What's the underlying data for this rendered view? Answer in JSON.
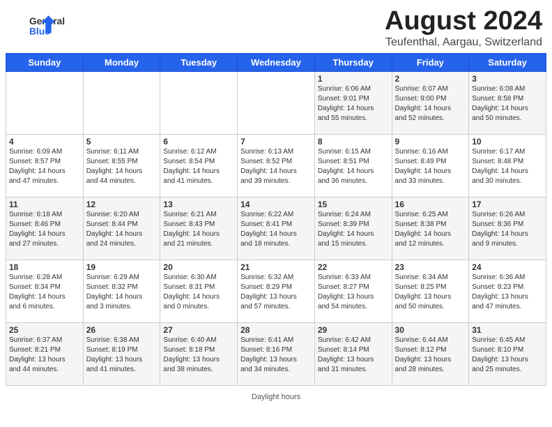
{
  "header": {
    "logo": {
      "line1": "General",
      "line2": "Blue"
    },
    "title": "August 2024",
    "subtitle": "Teufenthal, Aargau, Switzerland"
  },
  "days_of_week": [
    "Sunday",
    "Monday",
    "Tuesday",
    "Wednesday",
    "Thursday",
    "Friday",
    "Saturday"
  ],
  "weeks": [
    [
      {
        "day": "",
        "info": ""
      },
      {
        "day": "",
        "info": ""
      },
      {
        "day": "",
        "info": ""
      },
      {
        "day": "",
        "info": ""
      },
      {
        "day": "1",
        "info": "Sunrise: 6:06 AM\nSunset: 9:01 PM\nDaylight: 14 hours\nand 55 minutes."
      },
      {
        "day": "2",
        "info": "Sunrise: 6:07 AM\nSunset: 9:00 PM\nDaylight: 14 hours\nand 52 minutes."
      },
      {
        "day": "3",
        "info": "Sunrise: 6:08 AM\nSunset: 8:58 PM\nDaylight: 14 hours\nand 50 minutes."
      }
    ],
    [
      {
        "day": "4",
        "info": "Sunrise: 6:09 AM\nSunset: 8:57 PM\nDaylight: 14 hours\nand 47 minutes."
      },
      {
        "day": "5",
        "info": "Sunrise: 6:11 AM\nSunset: 8:55 PM\nDaylight: 14 hours\nand 44 minutes."
      },
      {
        "day": "6",
        "info": "Sunrise: 6:12 AM\nSunset: 8:54 PM\nDaylight: 14 hours\nand 41 minutes."
      },
      {
        "day": "7",
        "info": "Sunrise: 6:13 AM\nSunset: 8:52 PM\nDaylight: 14 hours\nand 39 minutes."
      },
      {
        "day": "8",
        "info": "Sunrise: 6:15 AM\nSunset: 8:51 PM\nDaylight: 14 hours\nand 36 minutes."
      },
      {
        "day": "9",
        "info": "Sunrise: 6:16 AM\nSunset: 8:49 PM\nDaylight: 14 hours\nand 33 minutes."
      },
      {
        "day": "10",
        "info": "Sunrise: 6:17 AM\nSunset: 8:48 PM\nDaylight: 14 hours\nand 30 minutes."
      }
    ],
    [
      {
        "day": "11",
        "info": "Sunrise: 6:18 AM\nSunset: 8:46 PM\nDaylight: 14 hours\nand 27 minutes."
      },
      {
        "day": "12",
        "info": "Sunrise: 6:20 AM\nSunset: 8:44 PM\nDaylight: 14 hours\nand 24 minutes."
      },
      {
        "day": "13",
        "info": "Sunrise: 6:21 AM\nSunset: 8:43 PM\nDaylight: 14 hours\nand 21 minutes."
      },
      {
        "day": "14",
        "info": "Sunrise: 6:22 AM\nSunset: 8:41 PM\nDaylight: 14 hours\nand 18 minutes."
      },
      {
        "day": "15",
        "info": "Sunrise: 6:24 AM\nSunset: 8:39 PM\nDaylight: 14 hours\nand 15 minutes."
      },
      {
        "day": "16",
        "info": "Sunrise: 6:25 AM\nSunset: 8:38 PM\nDaylight: 14 hours\nand 12 minutes."
      },
      {
        "day": "17",
        "info": "Sunrise: 6:26 AM\nSunset: 8:36 PM\nDaylight: 14 hours\nand 9 minutes."
      }
    ],
    [
      {
        "day": "18",
        "info": "Sunrise: 6:28 AM\nSunset: 8:34 PM\nDaylight: 14 hours\nand 6 minutes."
      },
      {
        "day": "19",
        "info": "Sunrise: 6:29 AM\nSunset: 8:32 PM\nDaylight: 14 hours\nand 3 minutes."
      },
      {
        "day": "20",
        "info": "Sunrise: 6:30 AM\nSunset: 8:31 PM\nDaylight: 14 hours\nand 0 minutes."
      },
      {
        "day": "21",
        "info": "Sunrise: 6:32 AM\nSunset: 8:29 PM\nDaylight: 13 hours\nand 57 minutes."
      },
      {
        "day": "22",
        "info": "Sunrise: 6:33 AM\nSunset: 8:27 PM\nDaylight: 13 hours\nand 54 minutes."
      },
      {
        "day": "23",
        "info": "Sunrise: 6:34 AM\nSunset: 8:25 PM\nDaylight: 13 hours\nand 50 minutes."
      },
      {
        "day": "24",
        "info": "Sunrise: 6:36 AM\nSunset: 8:23 PM\nDaylight: 13 hours\nand 47 minutes."
      }
    ],
    [
      {
        "day": "25",
        "info": "Sunrise: 6:37 AM\nSunset: 8:21 PM\nDaylight: 13 hours\nand 44 minutes."
      },
      {
        "day": "26",
        "info": "Sunrise: 6:38 AM\nSunset: 8:19 PM\nDaylight: 13 hours\nand 41 minutes."
      },
      {
        "day": "27",
        "info": "Sunrise: 6:40 AM\nSunset: 8:18 PM\nDaylight: 13 hours\nand 38 minutes."
      },
      {
        "day": "28",
        "info": "Sunrise: 6:41 AM\nSunset: 8:16 PM\nDaylight: 13 hours\nand 34 minutes."
      },
      {
        "day": "29",
        "info": "Sunrise: 6:42 AM\nSunset: 8:14 PM\nDaylight: 13 hours\nand 31 minutes."
      },
      {
        "day": "30",
        "info": "Sunrise: 6:44 AM\nSunset: 8:12 PM\nDaylight: 13 hours\nand 28 minutes."
      },
      {
        "day": "31",
        "info": "Sunrise: 6:45 AM\nSunset: 8:10 PM\nDaylight: 13 hours\nand 25 minutes."
      }
    ]
  ],
  "footer": {
    "text": "Daylight hours"
  }
}
